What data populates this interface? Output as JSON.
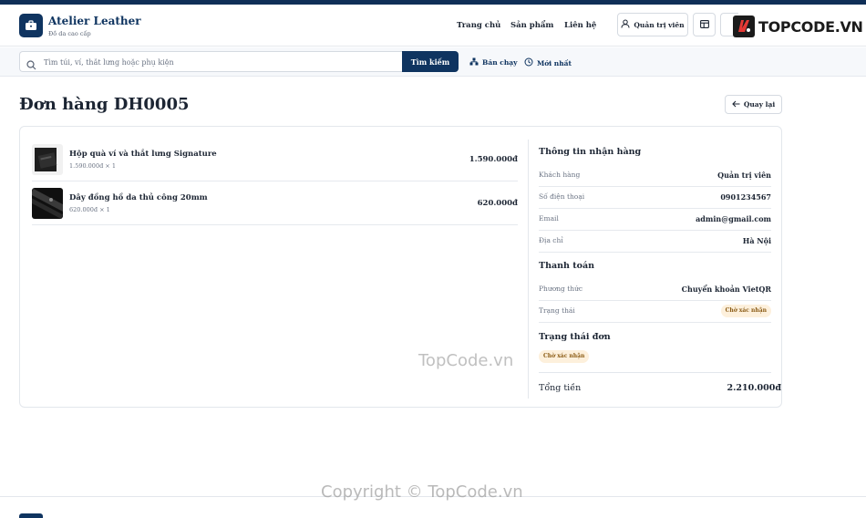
{
  "brand": {
    "name": "Atelier Leather",
    "tagline": "Đồ da cao cấp",
    "logo_icon": "briefcase-icon"
  },
  "nav": {
    "links": [
      "Trang chủ",
      "Sản phẩm",
      "Liên hệ"
    ],
    "account_label": "Quản trị viên",
    "account_icon": "user-icon",
    "dashboard_icon": "layout-icon"
  },
  "watermark": {
    "logo_text": "TOPCODE.VN",
    "center_text": "TopCode.vn",
    "bottom_text": "Copyright © TopCode.vn"
  },
  "search": {
    "placeholder": "Tìm túi, ví, thắt lưng hoặc phụ kiện",
    "button_label": "Tìm kiếm",
    "quick_links": [
      {
        "label": "Bán chạy",
        "icon": "bestseller-icon"
      },
      {
        "label": "Mới nhất",
        "icon": "clock-icon"
      }
    ]
  },
  "page": {
    "title": "Đơn hàng DH0005",
    "back_label": "Quay lại"
  },
  "order": {
    "items": [
      {
        "name": "Hộp quà ví và thắt lưng Signature",
        "meta": "1.590.000đ × 1",
        "price": "1.590.000đ"
      },
      {
        "name": "Dây đồng hồ da thủ công 20mm",
        "meta": "620.000đ × 1",
        "price": "620.000đ"
      }
    ]
  },
  "shipping": {
    "title": "Thông tin nhận hàng",
    "rows": [
      {
        "label": "Khách hàng",
        "value": "Quản trị viên"
      },
      {
        "label": "Số điện thoại",
        "value": "0901234567"
      },
      {
        "label": "Email",
        "value": "admin@gmail.com"
      },
      {
        "label": "Địa chỉ",
        "value": "Hà Nội"
      }
    ]
  },
  "payment": {
    "title": "Thanh toán",
    "method_label": "Phương thức",
    "method_value": "Chuyển khoản VietQR",
    "status_label": "Trạng thái",
    "status_value": "Chờ xác nhận"
  },
  "order_status": {
    "title": "Trạng thái đơn",
    "value": "Chờ xác nhận"
  },
  "total": {
    "label": "Tổng tiền",
    "value": "2.210.000đ"
  },
  "colors": {
    "primary": "#0f3460",
    "badge_bg": "#fdf0dc",
    "badge_text": "#8a5a13"
  }
}
